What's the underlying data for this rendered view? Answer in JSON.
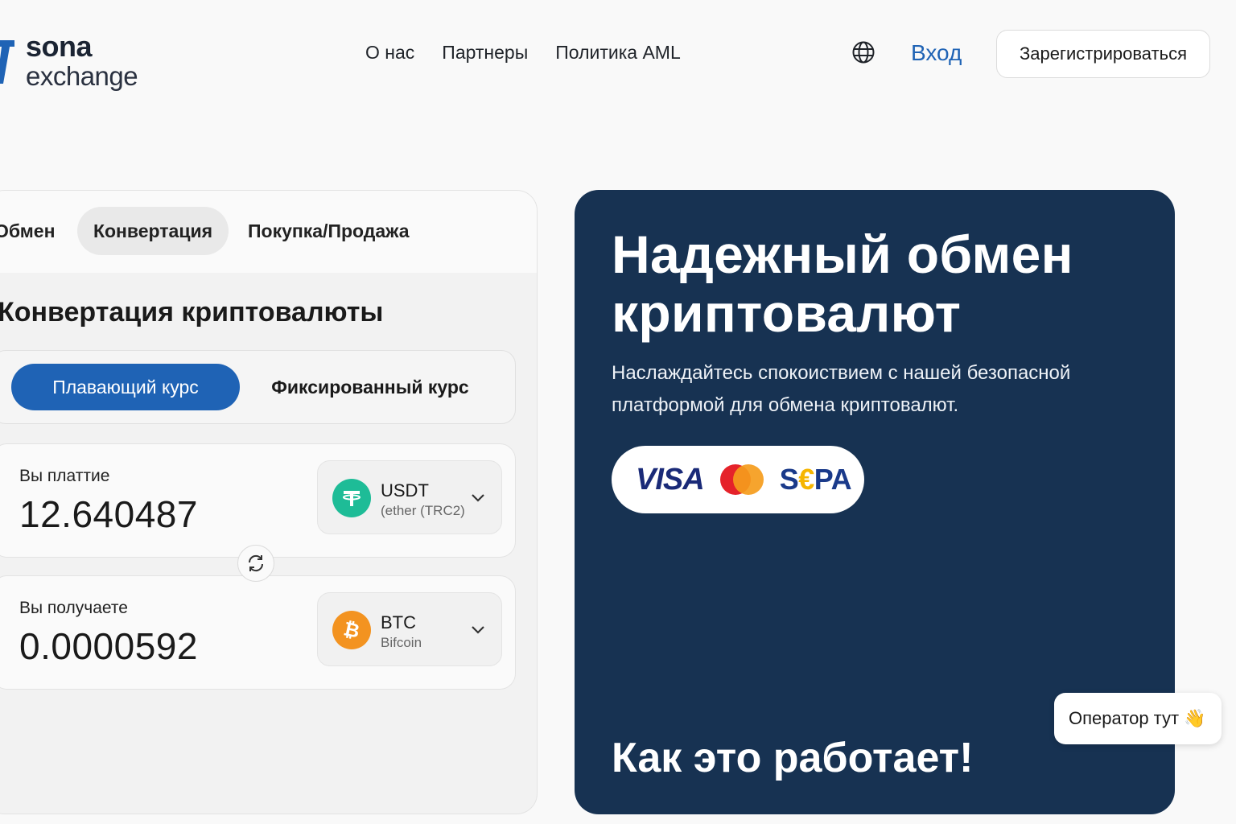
{
  "header": {
    "logo_name": "sona",
    "logo_sub": "exchange",
    "nav": [
      "О нас",
      "Партнеры",
      "Политика AML"
    ],
    "login": "Вход",
    "register": "Зарегистрироваться",
    "language_icon": "globe-icon",
    "accent_color": "#1f63b5"
  },
  "converter": {
    "tabs": [
      "Обмен",
      "Конвертация",
      "Покупка/Продажа"
    ],
    "active_tab": "Конвертация",
    "title": "Конвертация криптовалюты",
    "rate_modes": [
      "Плавающий курс",
      "Фиксированный курс"
    ],
    "active_rate": "Плавающий курс",
    "pay": {
      "label": "Вы платтие",
      "value": "12.640487",
      "currency_code": "USDT",
      "currency_name": "(ether (TRC2)"
    },
    "receive": {
      "label": "Вы получаете",
      "value": "0.0000592",
      "currency_code": "BTC",
      "currency_name": "Bifcoin"
    },
    "swap_icon": "swap-arrows-icon"
  },
  "hero": {
    "title": "Надежный обмен криптовалют",
    "subtitle": "Наслаждайтесь спокоиствием с нашей безопасной платформой для обмена криптовалют.",
    "payments": {
      "visa": "VISA",
      "sepa_s": "S",
      "sepa_e": "€",
      "sepa_pa": "PA"
    },
    "how_it_works": "Как это работает!",
    "background_color": "#173252"
  },
  "chat": {
    "operator_label": "Оператор тут",
    "wave_emoji": "👋"
  }
}
